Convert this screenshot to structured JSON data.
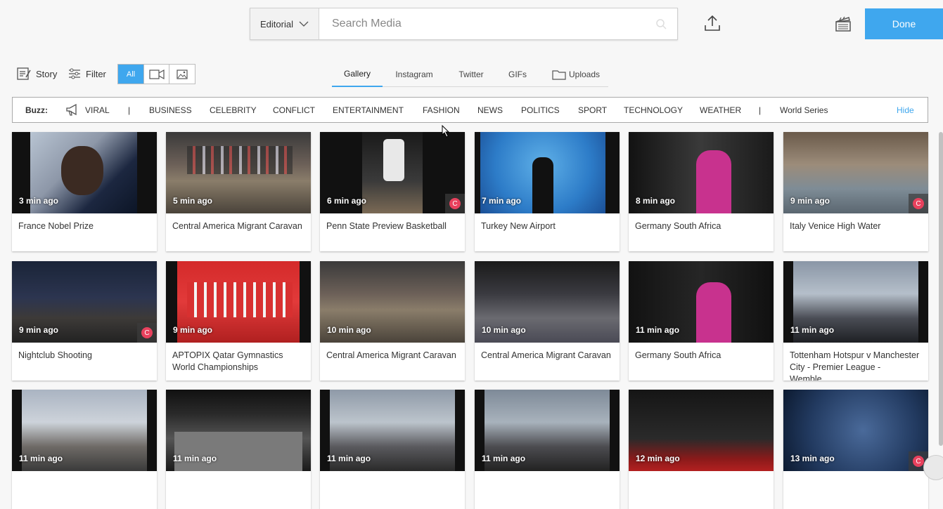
{
  "header": {
    "source_select": "Editorial",
    "search_placeholder": "Search Media",
    "done_label": "Done"
  },
  "toolbar": {
    "story_label": "Story",
    "filter_label": "Filter",
    "type_all": "All",
    "tabs": [
      "Gallery",
      "Instagram",
      "Twitter",
      "GIFs",
      "Uploads"
    ],
    "active_tab": "Gallery"
  },
  "buzz": {
    "label": "Buzz:",
    "items": [
      "VIRAL",
      "|",
      "BUSINESS",
      "CELEBRITY",
      "CONFLICT",
      "ENTERTAINMENT",
      "FASHION",
      "NEWS",
      "POLITICS",
      "SPORT",
      "TECHNOLOGY",
      "WEATHER",
      "|",
      "World Series"
    ],
    "hide_label": "Hide"
  },
  "colors": {
    "accent": "#3fa7ee",
    "badge": "#e8415d"
  },
  "gallery": [
    {
      "time": "3 min ago",
      "title": "France Nobel Prize",
      "badge": false
    },
    {
      "time": "5 min ago",
      "title": "Central America Migrant Caravan",
      "badge": false
    },
    {
      "time": "6 min ago",
      "title": "Penn State Preview Basketball",
      "badge": true
    },
    {
      "time": "7 min ago",
      "title": "Turkey New Airport",
      "badge": false
    },
    {
      "time": "8 min ago",
      "title": "Germany South Africa",
      "badge": false
    },
    {
      "time": "9 min ago",
      "title": "Italy Venice High Water",
      "badge": true
    },
    {
      "time": "9 min ago",
      "title": "Nightclub Shooting",
      "badge": true
    },
    {
      "time": "9 min ago",
      "title": "APTOPIX Qatar Gymnastics World Championships",
      "badge": false
    },
    {
      "time": "10 min ago",
      "title": "Central America Migrant Caravan",
      "badge": false
    },
    {
      "time": "10 min ago",
      "title": "Central America Migrant Caravan",
      "badge": false
    },
    {
      "time": "11 min ago",
      "title": "Germany South Africa",
      "badge": false
    },
    {
      "time": "11 min ago",
      "title": "Tottenham Hotspur v Manchester City - Premier League - Wemble…",
      "badge": false
    },
    {
      "time": "11 min ago",
      "title": "",
      "badge": false
    },
    {
      "time": "11 min ago",
      "title": "",
      "badge": false
    },
    {
      "time": "11 min ago",
      "title": "",
      "badge": false
    },
    {
      "time": "11 min ago",
      "title": "",
      "badge": false
    },
    {
      "time": "12 min ago",
      "title": "",
      "badge": false
    },
    {
      "time": "13 min ago",
      "title": "",
      "badge": true
    }
  ]
}
